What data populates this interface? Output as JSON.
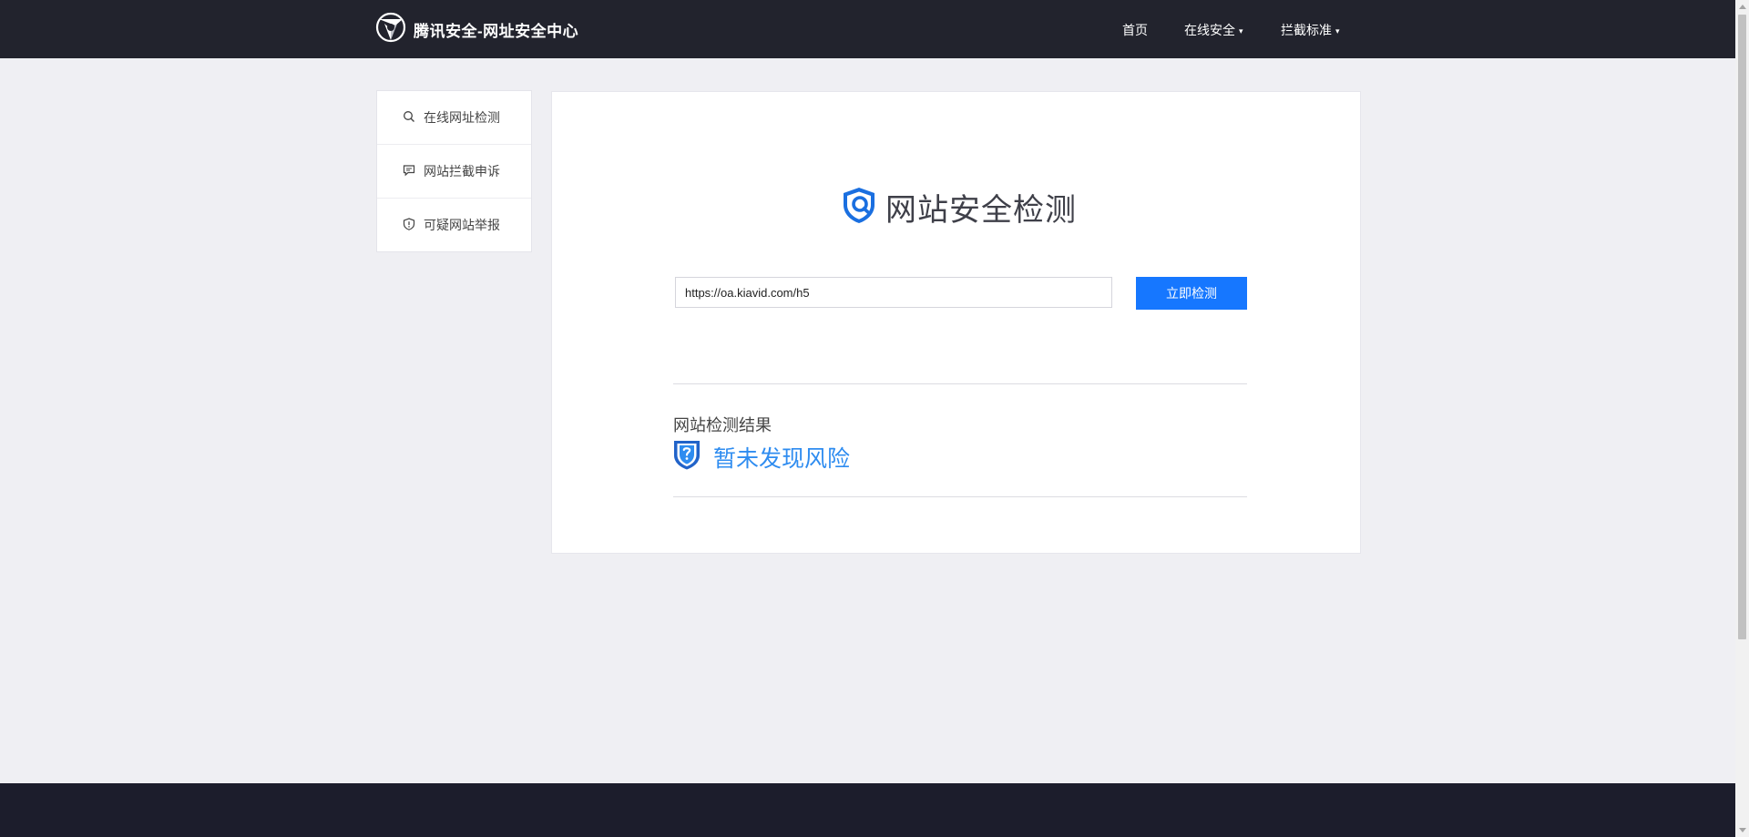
{
  "header": {
    "brand_text": "腾讯安全-网址安全中心",
    "brand_icon": "tencent-security-logo-icon",
    "nav": {
      "home": "首页",
      "online_security": "在线安全",
      "block_standard": "拦截标准"
    },
    "caret_glyph": "▾"
  },
  "sidebar": {
    "items": [
      {
        "label": "在线网址检测",
        "icon": "search-icon"
      },
      {
        "label": "网站拦截申诉",
        "icon": "message-icon"
      },
      {
        "label": "可疑网站举报",
        "icon": "shield-alert-icon"
      }
    ]
  },
  "main": {
    "title": "网站安全检测",
    "title_icon": "shield-search-icon",
    "url_input_value": "https://oa.kiavid.com/h5",
    "check_button": "立即检测",
    "result_title": "网站检测结果",
    "result_status": "暂未发现风险",
    "result_icon": "shield-question-icon",
    "accent_color": "#1677ff",
    "result_color": "#2e8cf0"
  }
}
